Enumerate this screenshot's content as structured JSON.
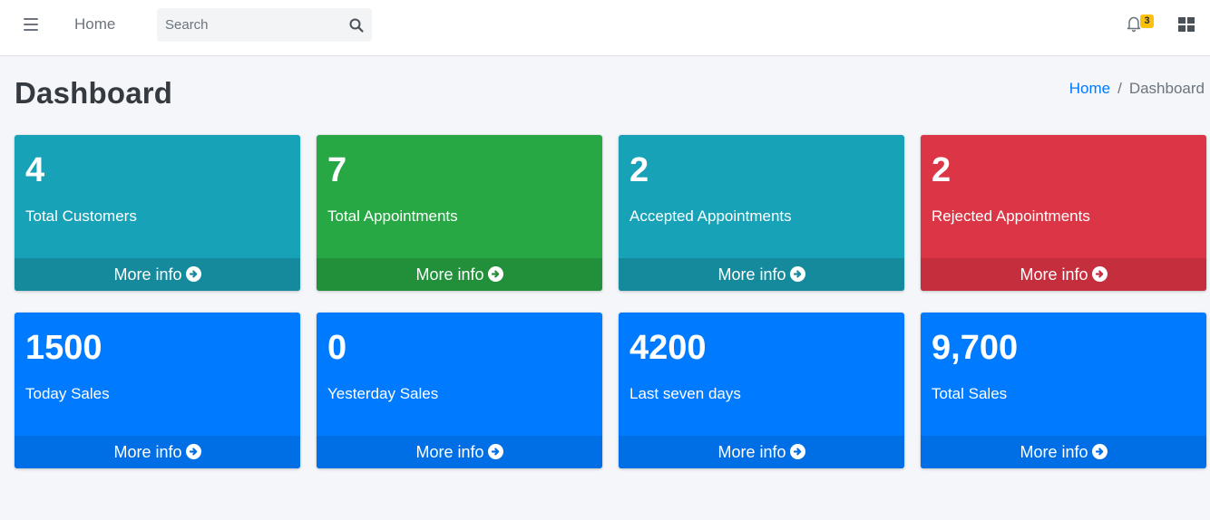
{
  "navbar": {
    "home_label": "Home",
    "search_placeholder": "Search",
    "notification_count": "3",
    "icons": [
      "menu-icon",
      "search-icon",
      "bell-icon",
      "apps-grid-icon"
    ]
  },
  "header": {
    "title": "Dashboard",
    "breadcrumb": {
      "home": "Home",
      "separator": "/",
      "current": "Dashboard"
    }
  },
  "cards": [
    {
      "value": "4",
      "label": "Total Customers",
      "footer": "More info",
      "color": "#17a2b8",
      "footer_color": "#148a9c"
    },
    {
      "value": "7",
      "label": "Total Appointments",
      "footer": "More info",
      "color": "#28a745",
      "footer_color": "#22903b"
    },
    {
      "value": "2",
      "label": "Accepted Appointments",
      "footer": "More info",
      "color": "#17a2b8",
      "footer_color": "#148a9c"
    },
    {
      "value": "2",
      "label": "Rejected Appointments",
      "footer": "More info",
      "color": "#dc3545",
      "footer_color": "#c52e3c"
    },
    {
      "value": "1500",
      "label": "Today Sales",
      "footer": "More info",
      "color": "#007bff",
      "footer_color": "#006fe6"
    },
    {
      "value": "0",
      "label": "Yesterday Sales",
      "footer": "More info",
      "color": "#007bff",
      "footer_color": "#006fe6"
    },
    {
      "value": "4200",
      "label": "Last seven days",
      "footer": "More info",
      "color": "#007bff",
      "footer_color": "#006fe6"
    },
    {
      "value": "9,700",
      "label": "Total Sales",
      "footer": "More info",
      "color": "#007bff",
      "footer_color": "#006fe6"
    }
  ]
}
